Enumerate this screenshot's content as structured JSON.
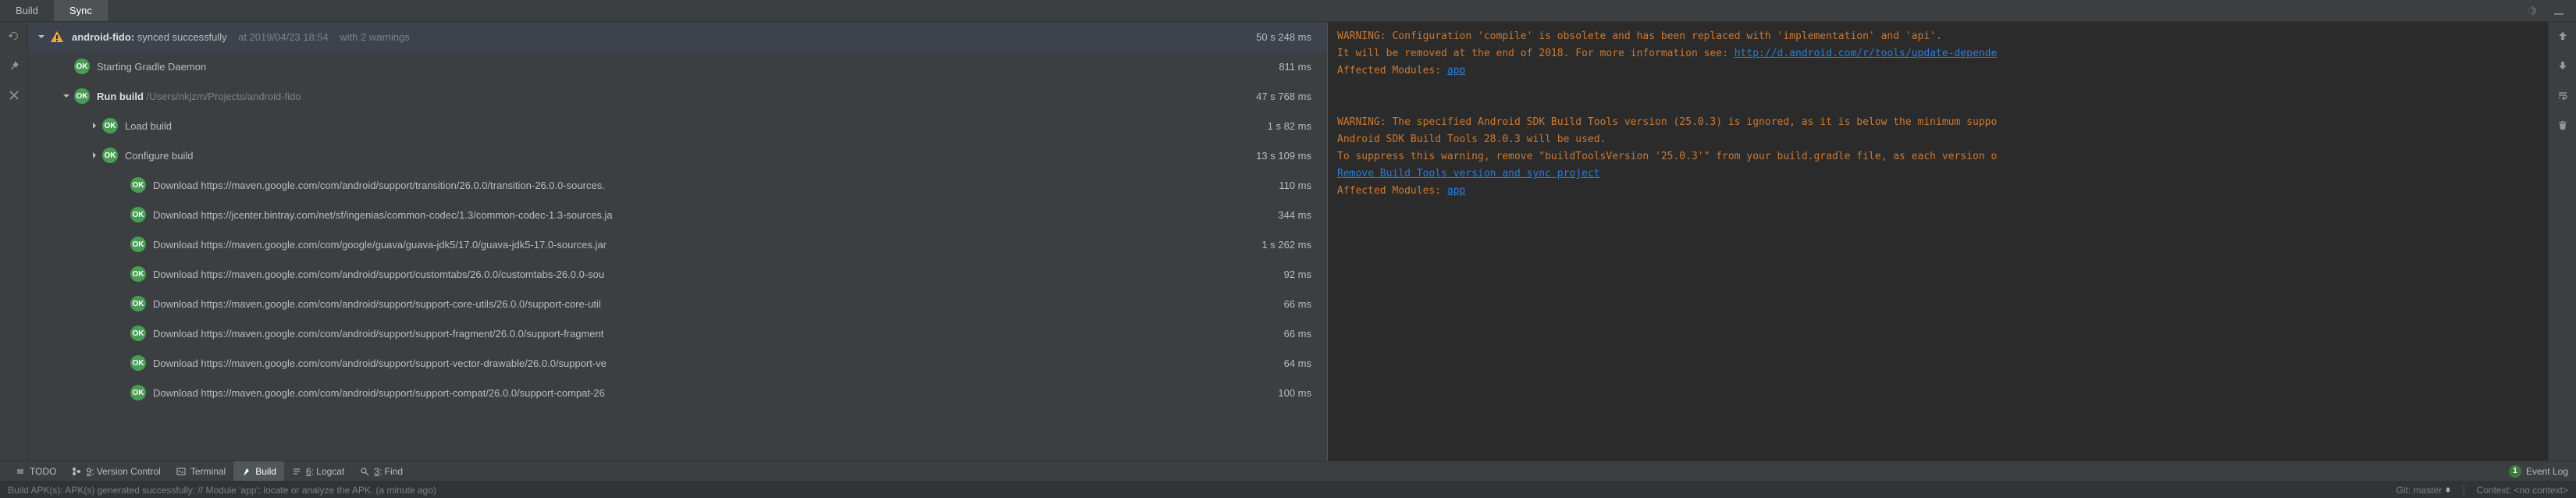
{
  "tabs": {
    "build": "Build",
    "sync": "Sync"
  },
  "header": {
    "project": "android-fido:",
    "status": "synced successfully",
    "timestamp": "at 2019/04/23 18:54",
    "warnings": "with 2 warnings",
    "duration": "50 s 248 ms"
  },
  "tree": [
    {
      "level": 1,
      "arrow": "none",
      "icon": "ok",
      "label": "Starting Gradle Daemon",
      "time": "811 ms"
    },
    {
      "level": 1,
      "arrow": "down",
      "icon": "ok",
      "bold": "Run build",
      "path": "/Users/nkjzm/Projects/android-fido",
      "time": "47 s 768 ms"
    },
    {
      "level": 2,
      "arrow": "right",
      "icon": "ok",
      "label": "Load build",
      "time": "1 s 82 ms"
    },
    {
      "level": 2,
      "arrow": "right",
      "icon": "ok",
      "label": "Configure build",
      "time": "13 s 109 ms"
    },
    {
      "level": 3,
      "arrow": "none",
      "icon": "ok",
      "label": "Download https://maven.google.com/com/android/support/transition/26.0.0/transition-26.0.0-sources.",
      "time": "110 ms"
    },
    {
      "level": 3,
      "arrow": "none",
      "icon": "ok",
      "label": "Download https://jcenter.bintray.com/net/sf/ingenias/common-codec/1.3/common-codec-1.3-sources.ja",
      "time": "344 ms"
    },
    {
      "level": 3,
      "arrow": "none",
      "icon": "ok",
      "label": "Download https://maven.google.com/com/google/guava/guava-jdk5/17.0/guava-jdk5-17.0-sources.jar",
      "time": "1 s 262 ms"
    },
    {
      "level": 3,
      "arrow": "none",
      "icon": "ok",
      "label": "Download https://maven.google.com/com/android/support/customtabs/26.0.0/customtabs-26.0.0-sou",
      "time": "92 ms"
    },
    {
      "level": 3,
      "arrow": "none",
      "icon": "ok",
      "label": "Download https://maven.google.com/com/android/support/support-core-utils/26.0.0/support-core-util",
      "time": "66 ms"
    },
    {
      "level": 3,
      "arrow": "none",
      "icon": "ok",
      "label": "Download https://maven.google.com/com/android/support/support-fragment/26.0.0/support-fragment",
      "time": "66 ms"
    },
    {
      "level": 3,
      "arrow": "none",
      "icon": "ok",
      "label": "Download https://maven.google.com/com/android/support/support-vector-drawable/26.0.0/support-ve",
      "time": "64 ms"
    },
    {
      "level": 3,
      "arrow": "none",
      "icon": "ok",
      "label": "Download https://maven.google.com/com/android/support/support-compat/26.0.0/support-compat-26",
      "time": "100 ms"
    }
  ],
  "warn": {
    "l1": "WARNING: Configuration 'compile' is obsolete and has been replaced with 'implementation' and 'api'.",
    "l2a": "It will be removed at the end of 2018. For more information see: ",
    "l2link": "http://d.android.com/r/tools/update-depende",
    "l3": "Affected Modules: ",
    "app": "app",
    "l5": "WARNING: The specified Android SDK Build Tools version (25.0.3) is ignored, as it is below the minimum suppo",
    "l6": "Android SDK Build Tools 28.0.3 will be used.",
    "l7": "To suppress this warning, remove \"buildToolsVersion '25.0.3'\" from your build.gradle file, as each version o",
    "l8link": "Remove Build Tools version and sync project",
    "l9": "Affected Modules: "
  },
  "status": {
    "todo": "TODO",
    "vcs": "9: Version Control",
    "terminal": "Terminal",
    "build": "Build",
    "logcat": "6: Logcat",
    "find": "3: Find",
    "eventlog": "Event Log",
    "eventcount": "1"
  },
  "footer": {
    "msg": "Build APK(s): APK(s) generated successfully: // Module 'app': locate or analyze the APK. (a minute ago)",
    "git": "Git: master",
    "context": "Context: <no context>"
  }
}
